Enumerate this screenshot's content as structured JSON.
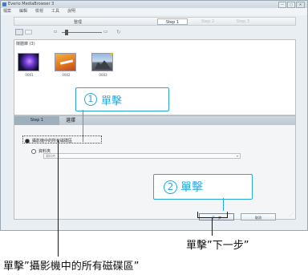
{
  "window": {
    "title": "Everio MediaBrowser 3",
    "menus": [
      "檔案",
      "編輯",
      "檢視",
      "工具",
      "說明"
    ],
    "controls": [
      "—",
      "□",
      "✕"
    ]
  },
  "stepbar": {
    "label": "整理",
    "tabs": [
      "Step 1",
      "Step 2",
      "Step 3"
    ]
  },
  "library": {
    "label": "媒體庫 (3)",
    "thumbnails": [
      {
        "caption": "0001"
      },
      {
        "caption": "0002"
      },
      {
        "caption": "0003"
      }
    ]
  },
  "panel": {
    "step_tab": "Step 1",
    "select_tab": "選擇"
  },
  "options": {
    "all_drives": "攝影機中的所有磁碟區",
    "folder_label": "資料夾",
    "folder_value": "資料夾: ..."
  },
  "buttons": {
    "next": "下一步",
    "cancel": "取消"
  },
  "callouts": [
    {
      "number": "1",
      "text": "單擊"
    },
    {
      "number": "2",
      "text": "單擊"
    }
  ],
  "captions": {
    "next": "單擊”下一步”",
    "drives": "單擊”攝影機中的所有磁碟區”"
  },
  "colors": {
    "accent": "#2aa7d9",
    "step_tab_bg": "#9fb0bd"
  },
  "icons": {
    "grid_view": "grid-view-icon",
    "list_view": "list-view-icon",
    "zoom_out": "zoom-out-icon",
    "zoom_in": "zoom-in-icon",
    "rotate": "rotate-icon",
    "favorite": "star-icon"
  }
}
